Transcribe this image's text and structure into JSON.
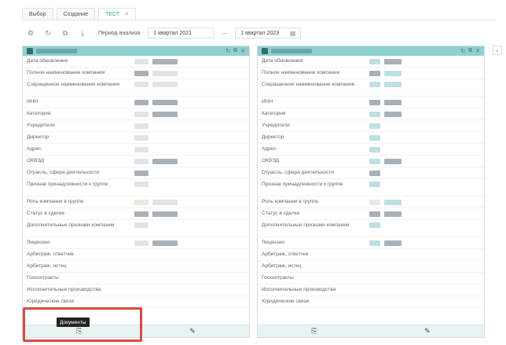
{
  "tabs": [
    {
      "label": "Выбор",
      "active": false,
      "closable": false
    },
    {
      "label": "Создание",
      "active": false,
      "closable": false
    },
    {
      "label": "ТЕСТ",
      "active": true,
      "closable": true
    }
  ],
  "toolbar": {
    "icons": [
      "gear-icon",
      "refresh-icon",
      "copy-icon",
      "download-icon"
    ],
    "period_label": "Период анализа",
    "date_from": "1 квартал 2021",
    "date_sep": "—",
    "date_to": "1 квартал 2023"
  },
  "panels": [
    {
      "rows": [
        {
          "label": "Дата обновления"
        },
        {
          "label": "Полное наименование компании"
        },
        {
          "label": "Сокращенное наименование компании"
        },
        {
          "label": "ИНН"
        },
        {
          "label": "Категория"
        },
        {
          "label": "Учредители"
        },
        {
          "label": "Директор"
        },
        {
          "label": "Адрес"
        },
        {
          "label": "ОКВЭД"
        },
        {
          "label": "Отрасль, сфера деятельности"
        },
        {
          "label": "Признак принадлежности к группе"
        },
        {
          "label": "Роль компании в группе"
        },
        {
          "label": "Статус в сделке"
        },
        {
          "label": "Дополнительные признаки компании"
        },
        {
          "label": "Лицензии"
        },
        {
          "label": "Арбитраж, ответчик"
        },
        {
          "label": "Арбитраж, истец"
        },
        {
          "label": "Госконтракты"
        },
        {
          "label": "Исполнительные производства"
        },
        {
          "label": "Юридические связи"
        }
      ]
    },
    {
      "rows": [
        {
          "label": "Дата обновления"
        },
        {
          "label": "Полное наименование компании"
        },
        {
          "label": "Сокращенное наименование компании"
        },
        {
          "label": "ИНН"
        },
        {
          "label": "Категория"
        },
        {
          "label": "Учредители"
        },
        {
          "label": "Директор"
        },
        {
          "label": "Адрес"
        },
        {
          "label": "ОКВЭД"
        },
        {
          "label": "Отрасль, сфера деятельности"
        },
        {
          "label": "Признак принадлежности к группе"
        },
        {
          "label": "Роль компании в группе"
        },
        {
          "label": "Статус в сделке"
        },
        {
          "label": "Дополнительные признаки компании"
        },
        {
          "label": "Лицензии"
        },
        {
          "label": "Арбитраж, ответчик"
        },
        {
          "label": "Арбитраж, истец"
        },
        {
          "label": "Госконтракты"
        },
        {
          "label": "Исполнительные производства"
        },
        {
          "label": "Юридические связи"
        }
      ]
    }
  ],
  "panel_header_icons": [
    "refresh-icon",
    "copy-icon",
    "close-icon"
  ],
  "footer_icons": [
    "documents-icon",
    "edit-icon"
  ],
  "tooltip": "Документы",
  "colors": {
    "accent": "#8fd0d2",
    "highlight": "#d94a45"
  }
}
